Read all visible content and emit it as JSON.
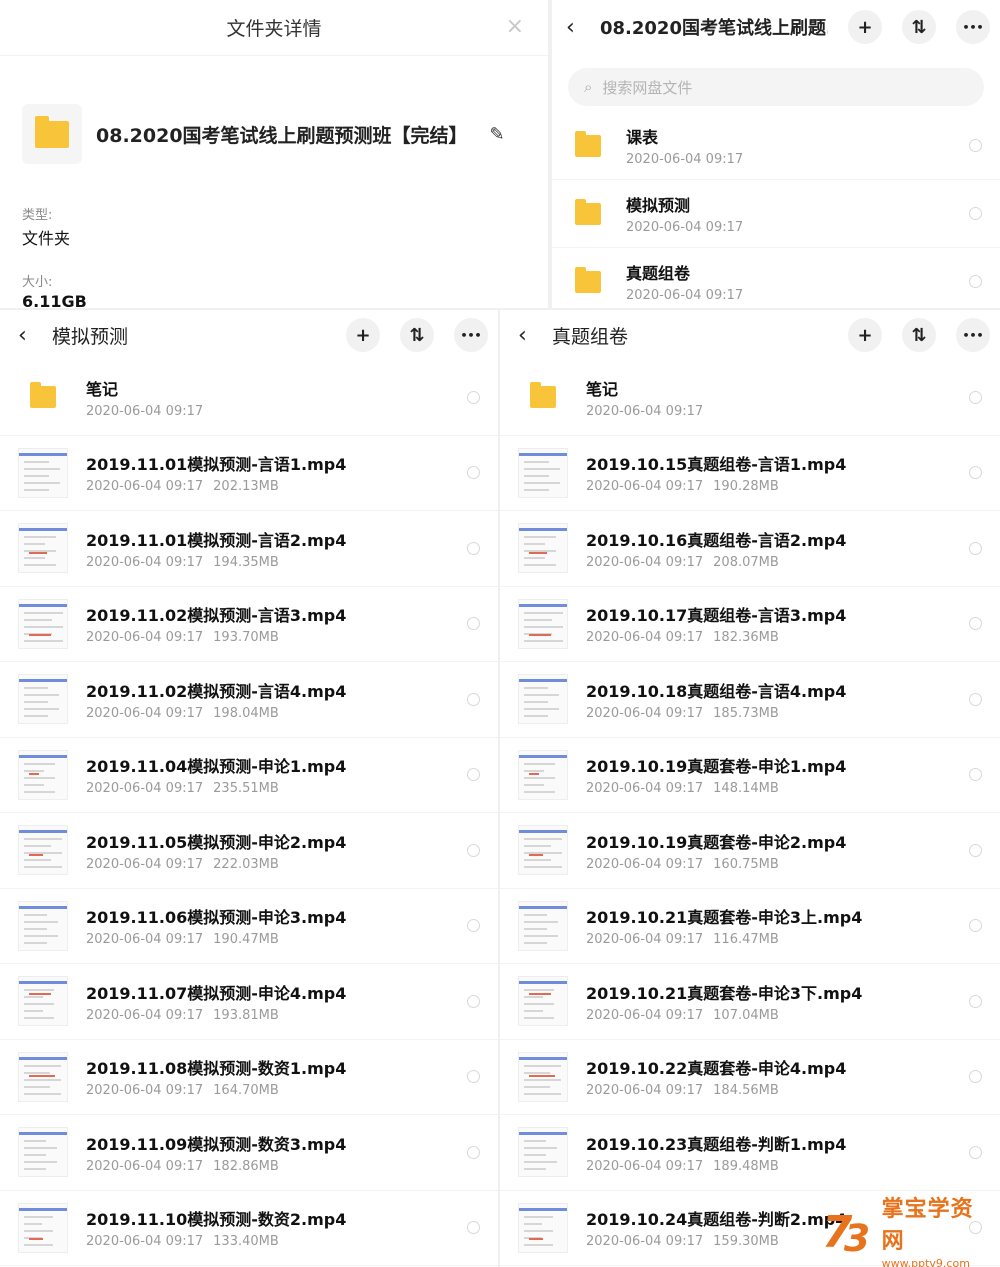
{
  "detail": {
    "title": "文件夹详情",
    "folder_name": "08.2020国考笔试线上刷题预测班【完结】",
    "type_label": "类型:",
    "type_value": "文件夹",
    "size_label": "大小:",
    "size_value": "6.11GB"
  },
  "top_right": {
    "title": "08.2020国考笔试线上刷题...",
    "search_placeholder": "搜索网盘文件",
    "items": [
      {
        "name": "课表",
        "date": "2020-06-04 09:17"
      },
      {
        "name": "模拟预测",
        "date": "2020-06-04 09:17"
      },
      {
        "name": "真题组卷",
        "date": "2020-06-04 09:17"
      }
    ]
  },
  "left": {
    "title": "模拟预测",
    "items": [
      {
        "name": "笔记",
        "date": "2020-06-04 09:17",
        "size": "",
        "folder": true
      },
      {
        "name": "2019.11.01模拟预测-言语1.mp4",
        "date": "2020-06-04 09:17",
        "size": "202.13MB"
      },
      {
        "name": "2019.11.01模拟预测-言语2.mp4",
        "date": "2020-06-04 09:17",
        "size": "194.35MB"
      },
      {
        "name": "2019.11.02模拟预测-言语3.mp4",
        "date": "2020-06-04 09:17",
        "size": "193.70MB"
      },
      {
        "name": "2019.11.02模拟预测-言语4.mp4",
        "date": "2020-06-04 09:17",
        "size": "198.04MB"
      },
      {
        "name": "2019.11.04模拟预测-申论1.mp4",
        "date": "2020-06-04 09:17",
        "size": "235.51MB"
      },
      {
        "name": "2019.11.05模拟预测-申论2.mp4",
        "date": "2020-06-04 09:17",
        "size": "222.03MB"
      },
      {
        "name": "2019.11.06模拟预测-申论3.mp4",
        "date": "2020-06-04 09:17",
        "size": "190.47MB"
      },
      {
        "name": "2019.11.07模拟预测-申论4.mp4",
        "date": "2020-06-04 09:17",
        "size": "193.81MB"
      },
      {
        "name": "2019.11.08模拟预测-数资1.mp4",
        "date": "2020-06-04 09:17",
        "size": "164.70MB"
      },
      {
        "name": "2019.11.09模拟预测-数资3.mp4",
        "date": "2020-06-04 09:17",
        "size": "182.86MB"
      },
      {
        "name": "2019.11.10模拟预测-数资2.mp4",
        "date": "2020-06-04 09:17",
        "size": "133.40MB"
      }
    ]
  },
  "right": {
    "title": "真题组卷",
    "items": [
      {
        "name": "笔记",
        "date": "2020-06-04 09:17",
        "size": "",
        "folder": true
      },
      {
        "name": "2019.10.15真题组卷-言语1.mp4",
        "date": "2020-06-04 09:17",
        "size": "190.28MB"
      },
      {
        "name": "2019.10.16真题组卷-言语2.mp4",
        "date": "2020-06-04 09:17",
        "size": "208.07MB"
      },
      {
        "name": "2019.10.17真题组卷-言语3.mp4",
        "date": "2020-06-04 09:17",
        "size": "182.36MB"
      },
      {
        "name": "2019.10.18真题组卷-言语4.mp4",
        "date": "2020-06-04 09:17",
        "size": "185.73MB"
      },
      {
        "name": "2019.10.19真题套卷-申论1.mp4",
        "date": "2020-06-04 09:17",
        "size": "148.14MB"
      },
      {
        "name": "2019.10.19真题套卷-申论2.mp4",
        "date": "2020-06-04 09:17",
        "size": "160.75MB"
      },
      {
        "name": "2019.10.21真题套卷-申论3上.mp4",
        "date": "2020-06-04 09:17",
        "size": "116.47MB"
      },
      {
        "name": "2019.10.21真题套卷-申论3下.mp4",
        "date": "2020-06-04 09:17",
        "size": "107.04MB"
      },
      {
        "name": "2019.10.22真题套卷-申论4.mp4",
        "date": "2020-06-04 09:17",
        "size": "184.56MB"
      },
      {
        "name": "2019.10.23真题组卷-判断1.mp4",
        "date": "2020-06-04 09:17",
        "size": "189.48MB"
      },
      {
        "name": "2019.10.24真题组卷-判断2.mp4",
        "date": "2020-06-04 09:17",
        "size": "159.30MB"
      }
    ]
  },
  "icons": {
    "back": "‹",
    "add": "+",
    "sort": "⇅",
    "more": "•••",
    "close": "×",
    "edit": "✎",
    "search": "⌕"
  },
  "colors": {
    "folder": "#f8c53a",
    "watermark": "#e8731d"
  },
  "watermark": {
    "title": "掌宝学资网",
    "url": "www.pptv9.com"
  }
}
